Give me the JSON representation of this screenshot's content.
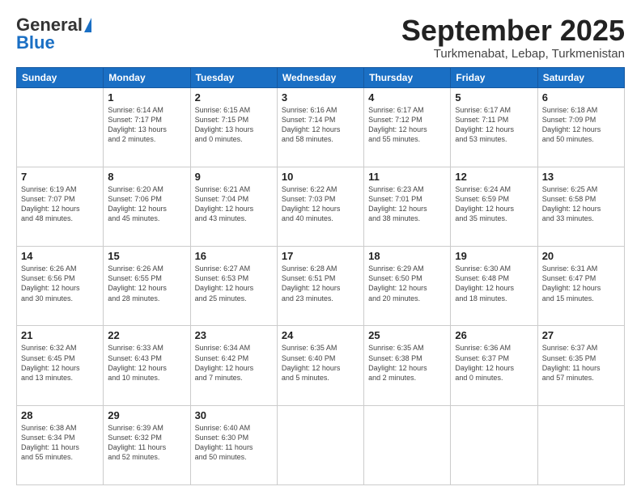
{
  "header": {
    "logo_general": "General",
    "logo_blue": "Blue",
    "month_title": "September 2025",
    "location": "Turkmenabat, Lebap, Turkmenistan"
  },
  "calendar": {
    "days_of_week": [
      "Sunday",
      "Monday",
      "Tuesday",
      "Wednesday",
      "Thursday",
      "Friday",
      "Saturday"
    ],
    "weeks": [
      [
        {
          "day": "",
          "info": ""
        },
        {
          "day": "1",
          "info": "Sunrise: 6:14 AM\nSunset: 7:17 PM\nDaylight: 13 hours\nand 2 minutes."
        },
        {
          "day": "2",
          "info": "Sunrise: 6:15 AM\nSunset: 7:15 PM\nDaylight: 13 hours\nand 0 minutes."
        },
        {
          "day": "3",
          "info": "Sunrise: 6:16 AM\nSunset: 7:14 PM\nDaylight: 12 hours\nand 58 minutes."
        },
        {
          "day": "4",
          "info": "Sunrise: 6:17 AM\nSunset: 7:12 PM\nDaylight: 12 hours\nand 55 minutes."
        },
        {
          "day": "5",
          "info": "Sunrise: 6:17 AM\nSunset: 7:11 PM\nDaylight: 12 hours\nand 53 minutes."
        },
        {
          "day": "6",
          "info": "Sunrise: 6:18 AM\nSunset: 7:09 PM\nDaylight: 12 hours\nand 50 minutes."
        }
      ],
      [
        {
          "day": "7",
          "info": "Sunrise: 6:19 AM\nSunset: 7:07 PM\nDaylight: 12 hours\nand 48 minutes."
        },
        {
          "day": "8",
          "info": "Sunrise: 6:20 AM\nSunset: 7:06 PM\nDaylight: 12 hours\nand 45 minutes."
        },
        {
          "day": "9",
          "info": "Sunrise: 6:21 AM\nSunset: 7:04 PM\nDaylight: 12 hours\nand 43 minutes."
        },
        {
          "day": "10",
          "info": "Sunrise: 6:22 AM\nSunset: 7:03 PM\nDaylight: 12 hours\nand 40 minutes."
        },
        {
          "day": "11",
          "info": "Sunrise: 6:23 AM\nSunset: 7:01 PM\nDaylight: 12 hours\nand 38 minutes."
        },
        {
          "day": "12",
          "info": "Sunrise: 6:24 AM\nSunset: 6:59 PM\nDaylight: 12 hours\nand 35 minutes."
        },
        {
          "day": "13",
          "info": "Sunrise: 6:25 AM\nSunset: 6:58 PM\nDaylight: 12 hours\nand 33 minutes."
        }
      ],
      [
        {
          "day": "14",
          "info": "Sunrise: 6:26 AM\nSunset: 6:56 PM\nDaylight: 12 hours\nand 30 minutes."
        },
        {
          "day": "15",
          "info": "Sunrise: 6:26 AM\nSunset: 6:55 PM\nDaylight: 12 hours\nand 28 minutes."
        },
        {
          "day": "16",
          "info": "Sunrise: 6:27 AM\nSunset: 6:53 PM\nDaylight: 12 hours\nand 25 minutes."
        },
        {
          "day": "17",
          "info": "Sunrise: 6:28 AM\nSunset: 6:51 PM\nDaylight: 12 hours\nand 23 minutes."
        },
        {
          "day": "18",
          "info": "Sunrise: 6:29 AM\nSunset: 6:50 PM\nDaylight: 12 hours\nand 20 minutes."
        },
        {
          "day": "19",
          "info": "Sunrise: 6:30 AM\nSunset: 6:48 PM\nDaylight: 12 hours\nand 18 minutes."
        },
        {
          "day": "20",
          "info": "Sunrise: 6:31 AM\nSunset: 6:47 PM\nDaylight: 12 hours\nand 15 minutes."
        }
      ],
      [
        {
          "day": "21",
          "info": "Sunrise: 6:32 AM\nSunset: 6:45 PM\nDaylight: 12 hours\nand 13 minutes."
        },
        {
          "day": "22",
          "info": "Sunrise: 6:33 AM\nSunset: 6:43 PM\nDaylight: 12 hours\nand 10 minutes."
        },
        {
          "day": "23",
          "info": "Sunrise: 6:34 AM\nSunset: 6:42 PM\nDaylight: 12 hours\nand 7 minutes."
        },
        {
          "day": "24",
          "info": "Sunrise: 6:35 AM\nSunset: 6:40 PM\nDaylight: 12 hours\nand 5 minutes."
        },
        {
          "day": "25",
          "info": "Sunrise: 6:35 AM\nSunset: 6:38 PM\nDaylight: 12 hours\nand 2 minutes."
        },
        {
          "day": "26",
          "info": "Sunrise: 6:36 AM\nSunset: 6:37 PM\nDaylight: 12 hours\nand 0 minutes."
        },
        {
          "day": "27",
          "info": "Sunrise: 6:37 AM\nSunset: 6:35 PM\nDaylight: 11 hours\nand 57 minutes."
        }
      ],
      [
        {
          "day": "28",
          "info": "Sunrise: 6:38 AM\nSunset: 6:34 PM\nDaylight: 11 hours\nand 55 minutes."
        },
        {
          "day": "29",
          "info": "Sunrise: 6:39 AM\nSunset: 6:32 PM\nDaylight: 11 hours\nand 52 minutes."
        },
        {
          "day": "30",
          "info": "Sunrise: 6:40 AM\nSunset: 6:30 PM\nDaylight: 11 hours\nand 50 minutes."
        },
        {
          "day": "",
          "info": ""
        },
        {
          "day": "",
          "info": ""
        },
        {
          "day": "",
          "info": ""
        },
        {
          "day": "",
          "info": ""
        }
      ]
    ]
  }
}
